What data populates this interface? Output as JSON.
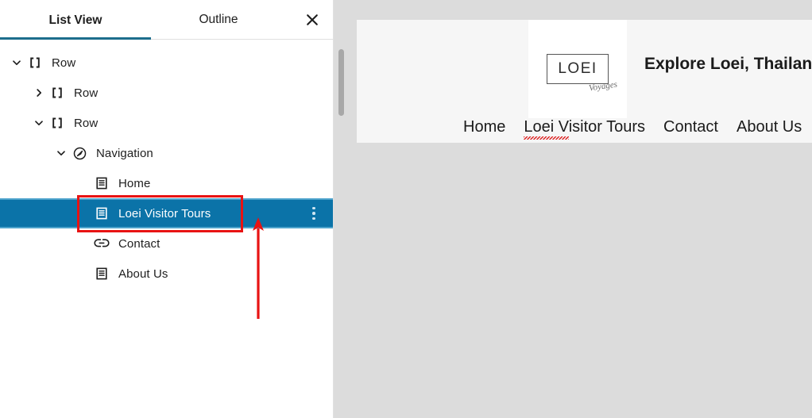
{
  "panel": {
    "tabs": [
      {
        "label": "List View",
        "active": true
      },
      {
        "label": "Outline",
        "active": false
      }
    ],
    "close_label": "Close",
    "close_icon": "close-icon",
    "scrollbar": {
      "name": "vertical-scrollbar"
    }
  },
  "tree": {
    "items": [
      {
        "label": "Row",
        "icon": "row-icon",
        "indent": 0,
        "chevron": "down",
        "selected": false
      },
      {
        "label": "Row",
        "icon": "row-icon",
        "indent": 1,
        "chevron": "right",
        "selected": false
      },
      {
        "label": "Row",
        "icon": "row-icon",
        "indent": 1,
        "chevron": "down",
        "selected": false
      },
      {
        "label": "Navigation",
        "icon": "navigation-icon",
        "indent": 2,
        "chevron": "down",
        "selected": false
      },
      {
        "label": "Home",
        "icon": "page-icon",
        "indent": 3,
        "chevron": "none",
        "selected": false
      },
      {
        "label": "Loei Visitor Tours",
        "icon": "page-icon",
        "indent": 3,
        "chevron": "none",
        "selected": true
      },
      {
        "label": "Contact",
        "icon": "link-icon",
        "indent": 3,
        "chevron": "none",
        "selected": false
      },
      {
        "label": "About Us",
        "icon": "page-icon",
        "indent": 3,
        "chevron": "none",
        "selected": false
      }
    ],
    "row_options_label": "Options"
  },
  "preview": {
    "logo_text": "LOEI",
    "logo_script": "Voyages",
    "tagline": "Explore Loei, Thailand",
    "nav_links": [
      {
        "label": "Home",
        "misspelled": false
      },
      {
        "label": "Loei Visitor Tours",
        "misspelled": true
      },
      {
        "label": "Contact",
        "misspelled": false
      },
      {
        "label": "About Us",
        "misspelled": false
      }
    ]
  },
  "annotations": {
    "highlight_box_target": "Loei Visitor Tours",
    "arrow_label": "points-to-selected-block"
  },
  "colors": {
    "selected_row_bg": "#0b73a8",
    "selected_row_border": "#4da3cc",
    "active_tab_underline": "#1d6e8c",
    "annotation_red": "#e81313",
    "panel_bg": "#ffffff",
    "canvas_bg": "#dcdcdc",
    "preview_bg": "#f6f6f6"
  }
}
